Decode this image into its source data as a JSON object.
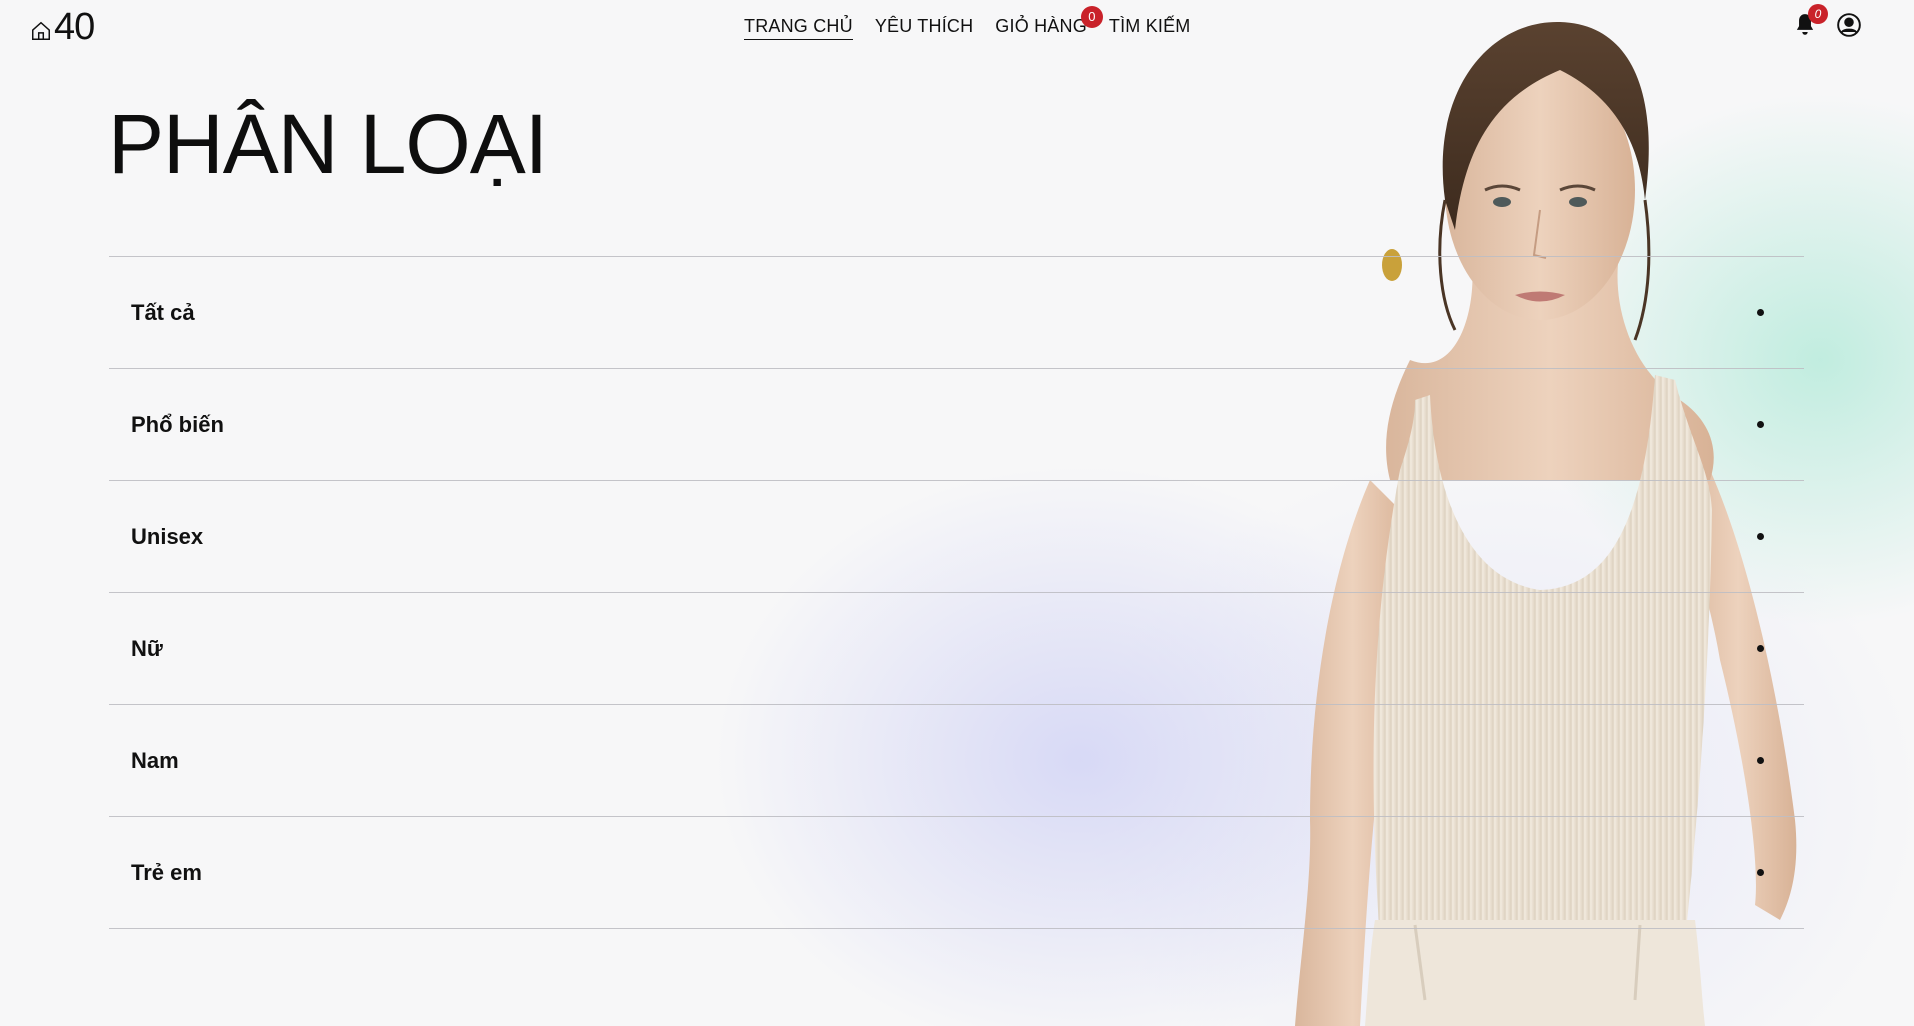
{
  "header": {
    "brand": "40",
    "nav": [
      {
        "label": "TRANG CHỦ",
        "active": true
      },
      {
        "label": "YÊU THÍCH",
        "active": false
      },
      {
        "label": "GIỎ HÀNG",
        "active": false,
        "badge": "0"
      },
      {
        "label": "TÌM KIẾM",
        "active": false
      }
    ],
    "notifications_count": "0",
    "icons": [
      "home-icon",
      "bell-icon",
      "user-circle-icon"
    ]
  },
  "page_title": "PHÂN LOẠI",
  "categories": [
    {
      "label": "Tất cả"
    },
    {
      "label": "Phổ biến"
    },
    {
      "label": "Unisex"
    },
    {
      "label": "Nữ"
    },
    {
      "label": "Nam"
    },
    {
      "label": "Trẻ em"
    }
  ],
  "colors": {
    "badge": "#c9222a",
    "text": "#111111",
    "divider": "#bebec3",
    "background": "#f7f7f8",
    "gradient_lavender": "#d2d4f5",
    "gradient_mint": "#beecde"
  }
}
